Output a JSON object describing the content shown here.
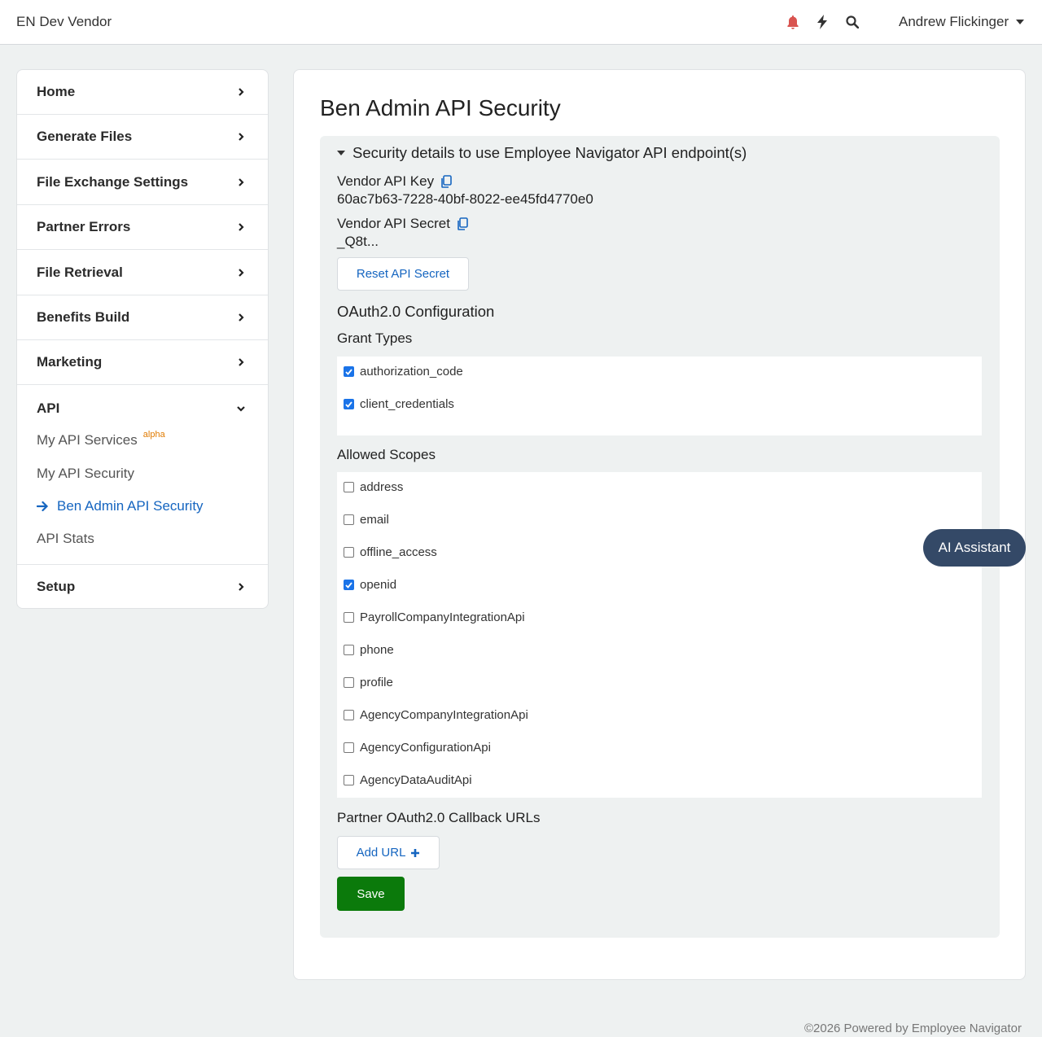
{
  "topbar": {
    "brand": "EN Dev Vendor",
    "icons": [
      "bell-icon",
      "bolt-icon",
      "search-icon"
    ],
    "user_name": "Andrew Flickinger"
  },
  "sidebar": {
    "items": [
      {
        "label": "Home"
      },
      {
        "label": "Generate Files"
      },
      {
        "label": "File Exchange Settings"
      },
      {
        "label": "Partner Errors"
      },
      {
        "label": "File Retrieval"
      },
      {
        "label": "Benefits Build"
      },
      {
        "label": "Marketing"
      },
      {
        "label": "API"
      },
      {
        "label": "Setup"
      }
    ],
    "api_sub": [
      {
        "label": "My API Services",
        "badge": "alpha"
      },
      {
        "label": "My API Security"
      },
      {
        "label": "Ben Admin API Security"
      },
      {
        "label": "API Stats"
      }
    ]
  },
  "main": {
    "title": "Ben Admin API Security",
    "panel_header": "Security details to use Employee Navigator API endpoint(s)",
    "vendor_key_label": "Vendor API Key",
    "vendor_key_value": "60ac7b63-7228-40bf-8022-ee45fd4770e0",
    "vendor_secret_label": "Vendor API Secret",
    "vendor_secret_value": "_Q8t...",
    "reset_button": "Reset API Secret",
    "oauth_heading": "OAuth2.0 Configuration",
    "grant_types_heading": "Grant Types",
    "grant_types": [
      {
        "label": "authorization_code",
        "checked": true
      },
      {
        "label": "client_credentials",
        "checked": true
      }
    ],
    "scopes_heading": "Allowed Scopes",
    "scopes": [
      {
        "label": "address",
        "checked": false
      },
      {
        "label": "email",
        "checked": false
      },
      {
        "label": "offline_access",
        "checked": false
      },
      {
        "label": "openid",
        "checked": true
      },
      {
        "label": "PayrollCompanyIntegrationApi",
        "checked": false
      },
      {
        "label": "phone",
        "checked": false
      },
      {
        "label": "profile",
        "checked": false
      },
      {
        "label": "AgencyCompanyIntegrationApi",
        "checked": false
      },
      {
        "label": "AgencyConfigurationApi",
        "checked": false
      },
      {
        "label": "AgencyDataAuditApi",
        "checked": false
      }
    ],
    "callback_heading": "Partner OAuth2.0 Callback URLs",
    "add_url_button": "Add URL",
    "save_button": "Save"
  },
  "ai_assistant": "AI Assistant",
  "footer": "©2026 Powered by Employee Navigator",
  "colors": {
    "accent": "#1565c0",
    "save": "#0b7a0b",
    "ai_button": "#344967",
    "bell": "#d9534f"
  }
}
